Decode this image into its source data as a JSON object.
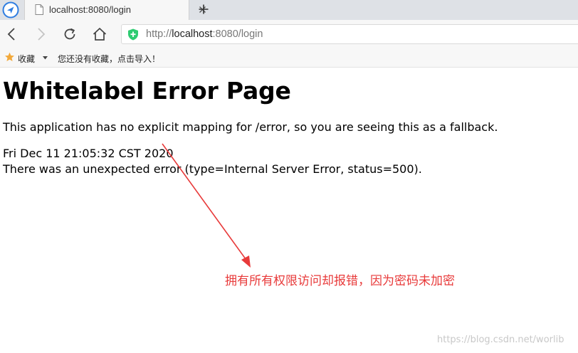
{
  "browser": {
    "tab": {
      "title": "localhost:8080/login"
    },
    "address": {
      "scheme": "http://",
      "host": "localhost",
      "rest": ":8080/login"
    },
    "bookmarks": {
      "favorites_label": "收藏",
      "import_hint": "您还没有收藏，点击导入！"
    },
    "icons": [
      "browser-logo-icon",
      "page-icon",
      "close-icon",
      "plus-icon",
      "back-icon",
      "forward-icon",
      "reload-icon",
      "home-icon",
      "shield-icon",
      "star-icon",
      "caret-down-icon"
    ],
    "colors": {
      "accent": "#2f7de1",
      "shield": "#2ecb71",
      "star": "#f2a93b"
    }
  },
  "page": {
    "heading": "Whitelabel Error Page",
    "message": "This application has no explicit mapping for /error, so you are seeing this as a fallback.",
    "timestamp": "Fri Dec 11 21:05:32 CST 2020",
    "error_detail": "There was an unexpected error (type=Internal Server Error, status=500)."
  },
  "annotation": {
    "text": "拥有所有权限访问却报错，因为密码未加密",
    "color": "#e83a3a"
  },
  "watermark": "https://blog.csdn.net/worlib"
}
